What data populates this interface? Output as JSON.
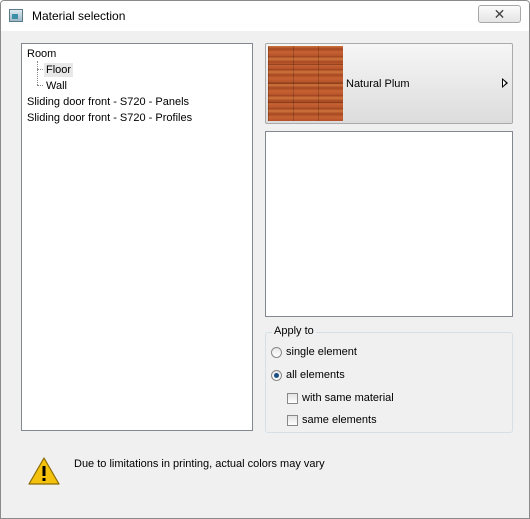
{
  "window": {
    "title": "Material selection",
    "close_glyph": "✕"
  },
  "tree": {
    "items": [
      {
        "label": "Room"
      },
      {
        "label": "Floor"
      },
      {
        "label": "Wall"
      },
      {
        "label": "Sliding door front - S720 - Panels"
      },
      {
        "label": "Sliding door front - S720 - Profiles"
      }
    ],
    "selected": "Floor"
  },
  "material": {
    "name": "Natural Plum",
    "swatch_color": "#b85a2c",
    "arrow_icon": "triangle-right-icon"
  },
  "apply_to": {
    "title": "Apply to",
    "single_element": "single element",
    "all_elements": "all elements",
    "with_same_material": "with same material",
    "same_elements": "same elements",
    "selected_option": "all elements",
    "with_same_material_checked": false,
    "same_elements_checked": false
  },
  "warning": {
    "icon": "warning-icon",
    "text": "Due to limitations in printing, actual colors may vary",
    "icon_color": "#f4c20d"
  }
}
